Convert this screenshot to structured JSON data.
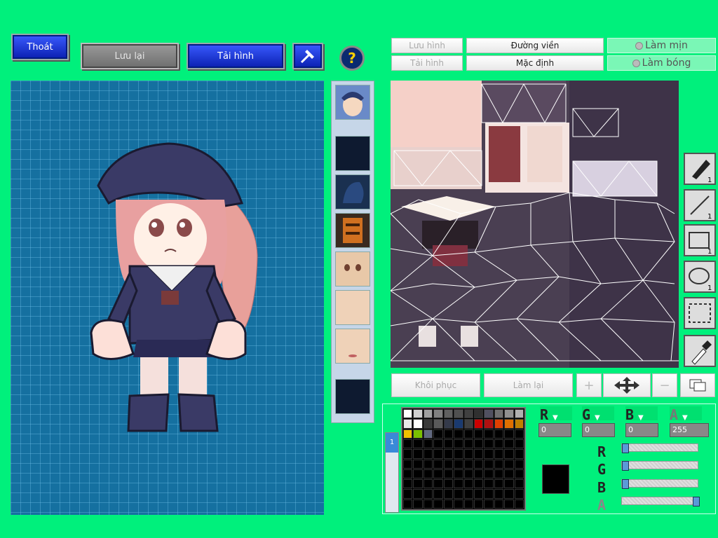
{
  "toolbar": {
    "exit_label": "Thoát",
    "save_label": "Lưu lại",
    "reload_label": "Tải hình",
    "help_glyph": "?"
  },
  "texture_toolbar": {
    "save_image": "Lưu hình",
    "load_image": "Tải hình",
    "outline": "Đường viền",
    "default": "Mặc định",
    "smooth": "Làm mịn",
    "shade": "Làm bóng"
  },
  "edit_bar": {
    "restore": "Khôi phục",
    "redo": "Làm lại"
  },
  "tools": [
    {
      "name": "pen",
      "size": "1"
    },
    {
      "name": "line",
      "size": "1"
    },
    {
      "name": "rectangle",
      "size": "1"
    },
    {
      "name": "ellipse",
      "size": "1"
    },
    {
      "name": "selection",
      "size": ""
    },
    {
      "name": "eyedropper",
      "size": ""
    }
  ],
  "palette_tab": "1",
  "palette_row1": [
    "#ffffff",
    "#d0d0d0",
    "#a0a0a0",
    "#808080",
    "#606060",
    "#505050",
    "#404040",
    "#303030",
    "#505060",
    "#707070",
    "#909090",
    "#b0b0b0"
  ],
  "palette_row2": [
    "#e8e8e8",
    "#ffffff",
    "#3a3a3a",
    "#5a5a5a",
    "#343a4a",
    "#1a3a70",
    "#404040",
    "#cc0000",
    "#b01010",
    "#e04000",
    "#e07000",
    "#c08000"
  ],
  "palette_row3": [
    "#f0c000",
    "#7ac000",
    "#606880"
  ],
  "color": {
    "r_label": "R",
    "g_label": "G",
    "b_label": "B",
    "a_label": "A",
    "r": "0",
    "g": "0",
    "b": "0",
    "a": "255",
    "current": "#000000"
  },
  "parts": [
    "face",
    "empty",
    "hair",
    "clothes",
    "face-1",
    "face-2",
    "face-3",
    "empty"
  ]
}
